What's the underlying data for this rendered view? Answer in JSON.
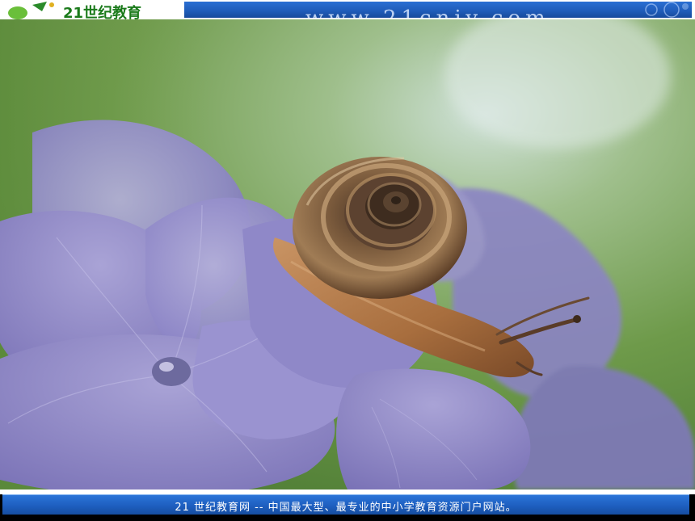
{
  "header": {
    "logo_text": "21世纪教育",
    "url_text": "www.21cnjy.com"
  },
  "photo": {
    "subject": "snail-on-hydrangea",
    "colors": {
      "background_green": "#6e9a4a",
      "petal_purple": "#8a83c8",
      "shell_brown": "#8a6a45",
      "body_tan": "#b07a48"
    }
  },
  "footer": {
    "text": "21 世纪教育网 -- 中国最大型、最专业的中小学教育资源门户网站。"
  },
  "colors": {
    "bar_blue": "#1f5bb8",
    "header_white": "#ffffff"
  }
}
